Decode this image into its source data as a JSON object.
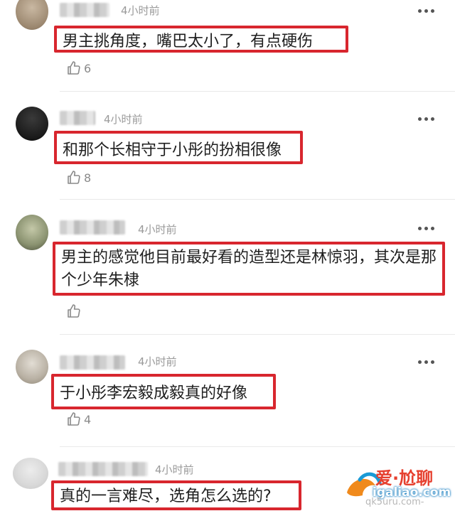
{
  "comments": [
    {
      "time": "4小时前",
      "text": "男主挑角度，嘴巴太小了，有点硬伤",
      "likes": "6"
    },
    {
      "time": "4小时前",
      "text": "和那个长相守于小彤的扮相很像",
      "likes": "8"
    },
    {
      "time": "4小时前",
      "text": "男主的感觉他目前最好看的造型还是林惊羽，其次是那个少年朱棣",
      "likes": ""
    },
    {
      "time": "4小时前",
      "text": "于小彤李宏毅成毅真的好像",
      "likes": "4"
    },
    {
      "time": "4小时前",
      "text": "真的一言难尽，选角怎么选的?",
      "likes": ""
    }
  ],
  "watermark": {
    "line1": "爱·尬聊",
    "line2": "igaliao.com",
    "line3": "qk5uru.com-"
  }
}
